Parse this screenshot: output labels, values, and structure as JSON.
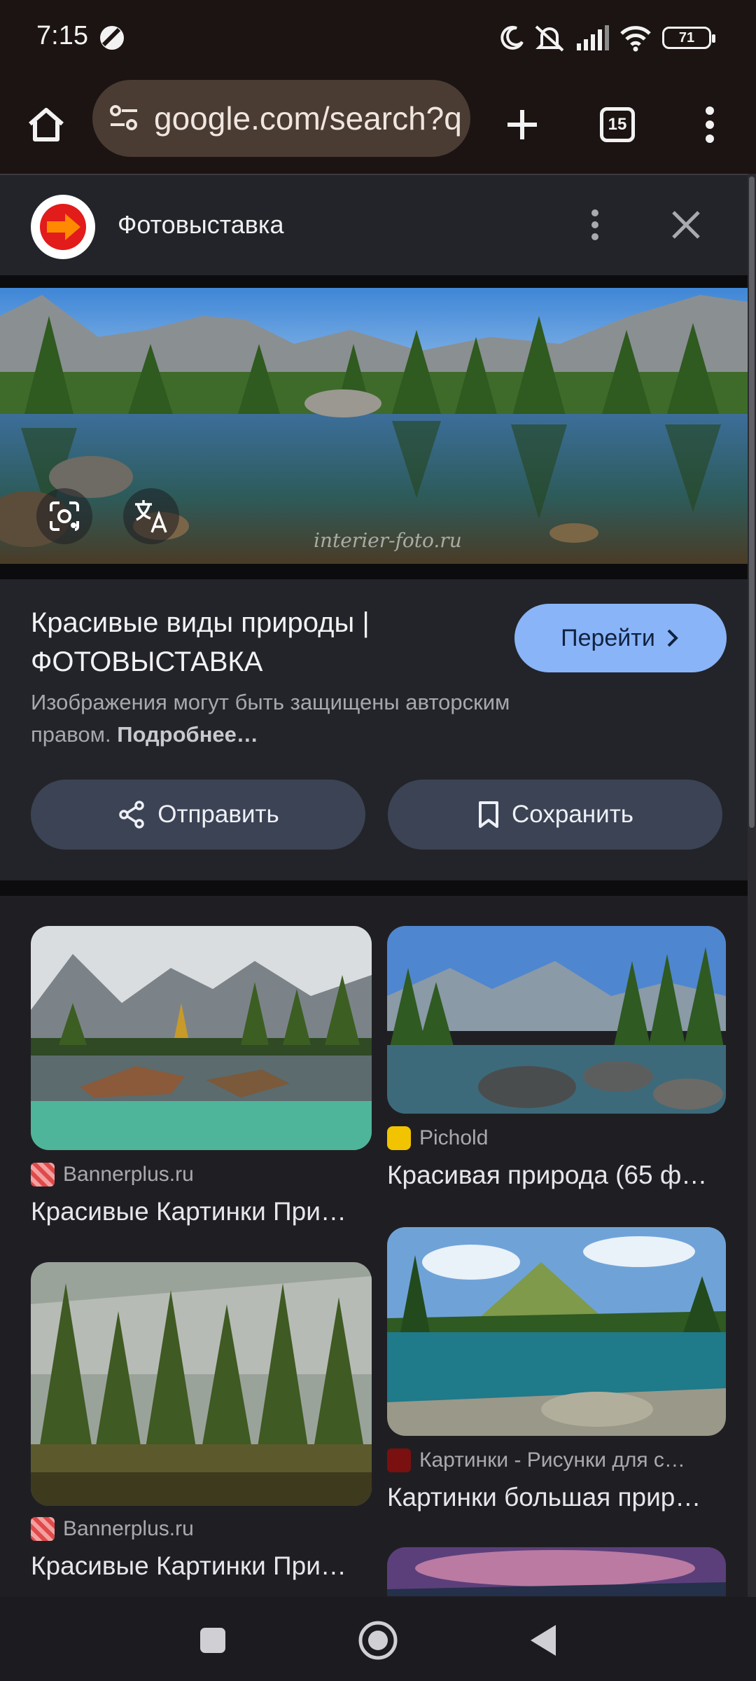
{
  "status_bar": {
    "time": "7:15",
    "battery": "71",
    "icons": [
      "do-not-disturb-moon-icon",
      "vibrate-off-icon",
      "signal-icon",
      "wifi-icon",
      "battery-icon"
    ]
  },
  "browser": {
    "url": "google.com/search?q",
    "tab_count": "15",
    "accent_color": "#4a3b33"
  },
  "sheet": {
    "site_name": "Фотовыставка",
    "hero_credit": "interier-foto.ru",
    "result_title": "Красивые виды природы | ФОТОВЫСТАВКА",
    "copyright_note": "Изображения могут быть защищены авторским правом.",
    "more_link": "Подробнее…",
    "visit_label": "Перейти",
    "share_label": "Отправить",
    "save_label": "Сохранить",
    "visit_color": "#8ab4f8"
  },
  "related": [
    {
      "source": "Bannerplus.ru",
      "caption": "Красивые Картинки При…"
    },
    {
      "source": "Pichold",
      "caption": "Красивая природа (65 ф…"
    },
    {
      "source": "Bannerplus.ru",
      "caption": "Красивые Картинки При…"
    },
    {
      "source": "Картинки - Рисунки для с…",
      "caption": "Картинки большая прир…"
    }
  ]
}
